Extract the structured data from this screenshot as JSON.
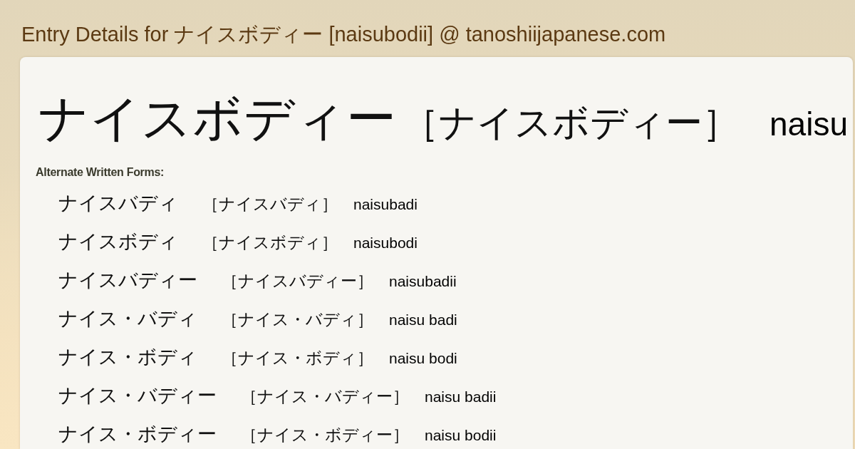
{
  "page_title": "Entry Details for ナイスボディー [naisubodii] @ tanoshiijapanese.com",
  "entry": {
    "word": "ナイスボディー",
    "reading": "［ナイスボディー］",
    "romaji": "naisu"
  },
  "alternate_forms": {
    "label": "Alternate Written Forms:",
    "items": [
      {
        "word": "ナイスバディ",
        "reading": "［ナイスバディ］",
        "romaji": "naisubadi"
      },
      {
        "word": "ナイスボディ",
        "reading": "［ナイスボディ］",
        "romaji": "naisubodi"
      },
      {
        "word": "ナイスバディー",
        "reading": "［ナイスバディー］",
        "romaji": "naisubadii"
      },
      {
        "word": "ナイス・バディ",
        "reading": "［ナイス・バディ］",
        "romaji": "naisu badi"
      },
      {
        "word": "ナイス・ボディ",
        "reading": "［ナイス・ボディ］",
        "romaji": "naisu bodi"
      },
      {
        "word": "ナイス・バディー",
        "reading": "［ナイス・バディー］",
        "romaji": "naisu badii"
      },
      {
        "word": "ナイス・ボディー",
        "reading": "［ナイス・ボディー］",
        "romaji": "naisu bodii"
      }
    ]
  }
}
